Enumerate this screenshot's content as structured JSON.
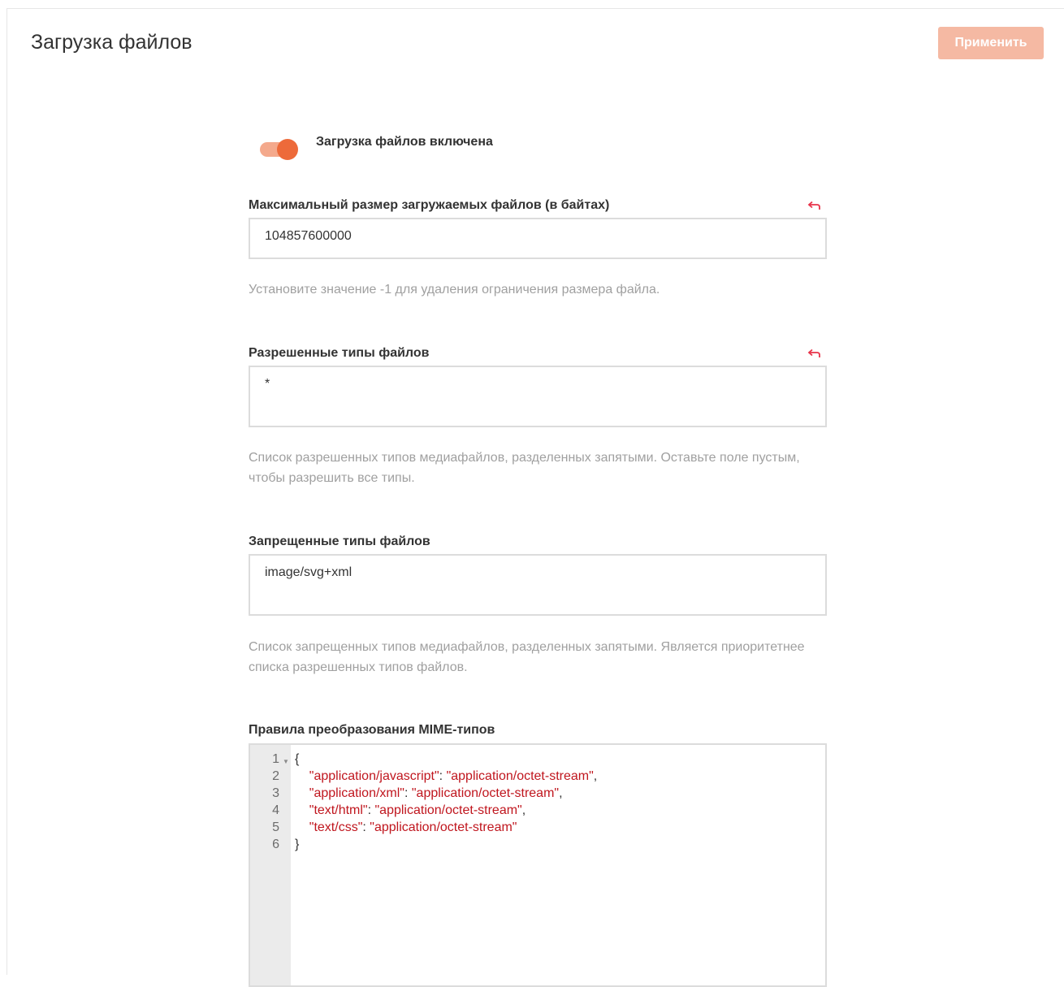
{
  "header": {
    "title": "Загрузка файлов",
    "apply_label": "Применить"
  },
  "upload_toggle": {
    "label": "Загрузка файлов включена",
    "enabled": true
  },
  "max_size": {
    "label": "Максимальный размер загружаемых файлов (в байтах)",
    "value": "104857600000",
    "help": "Установите значение -1 для удаления ограничения размера файла."
  },
  "allowed_types": {
    "label": "Разрешенные типы файлов",
    "value": "*",
    "help": "Список разрешенных типов медиафайлов, разделенных запятыми. Оставьте поле пустым, чтобы разрешить все типы."
  },
  "forbidden_types": {
    "label": "Запрещенные типы файлов",
    "value": "image/svg+xml",
    "help": "Список запрещенных типов медиафайлов, разделенных запятыми. Является приоритетнее списка разрешенных типов файлов."
  },
  "mime_rules": {
    "label": "Правила преобразования MIME-типов",
    "line_numbers": [
      "1",
      "2",
      "3",
      "4",
      "5",
      "6"
    ],
    "open_brace": "{",
    "close_brace": "}",
    "entries": [
      {
        "key": "\"application/javascript\"",
        "value": "\"application/octet-stream\"",
        "sep": ","
      },
      {
        "key": "\"application/xml\"",
        "value": "\"application/octet-stream\"",
        "sep": ","
      },
      {
        "key": "\"text/html\"",
        "value": "\"application/octet-stream\"",
        "sep": ","
      },
      {
        "key": "\"text/css\"",
        "value": "\"application/octet-stream\"",
        "sep": ""
      }
    ]
  },
  "colors": {
    "accent": "#ed6a3a",
    "accent_light": "#f4a98c",
    "apply_disabled": "#f5b9a3",
    "reset_icon": "#e8334a",
    "code_string": "#c0161e"
  },
  "icons": {
    "reset": "undo-arrow-icon",
    "fold": "fold-triangle-icon"
  }
}
